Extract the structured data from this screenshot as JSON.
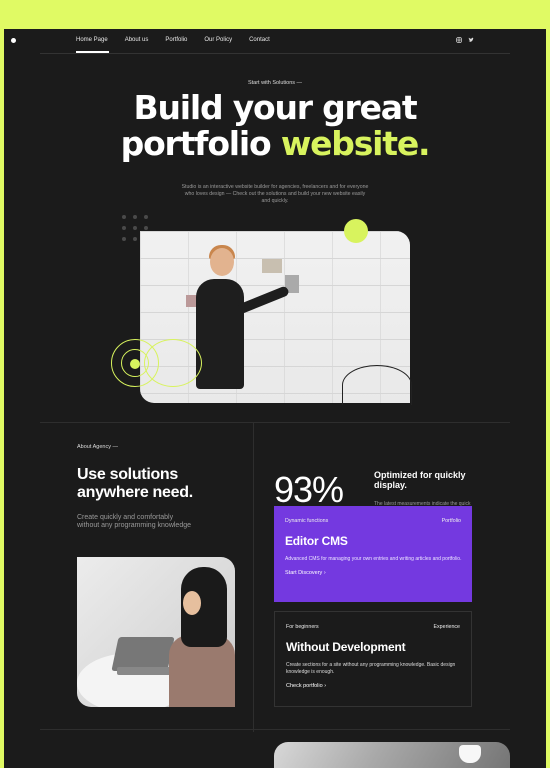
{
  "nav": {
    "items": [
      {
        "label": "Home Page",
        "active": true
      },
      {
        "label": "About us",
        "active": false
      },
      {
        "label": "Portfolio",
        "active": false
      },
      {
        "label": "Our Policy",
        "active": false
      },
      {
        "label": "Contact",
        "active": false
      }
    ],
    "social": [
      "instagram-icon",
      "twitter-icon"
    ]
  },
  "hero": {
    "eyebrow": "Start with Solutions —",
    "title_line1": "Build your great",
    "title_line2_a": "portfolio",
    "title_line2_b": "website.",
    "subtitle": "Studio is an interactive website builder for agencies, freelancers and for everyone who loves design — Check out the solutions and build your new website easily and quickly."
  },
  "about": {
    "eyebrow": "About Agency —",
    "title": "Use solutions anywhere need.",
    "subtitle": "Create quickly and comfortably without any programming knowledge"
  },
  "stat": {
    "value": "93%",
    "title": "Optimized for quickly display.",
    "description": "The latest measurements indicate the quick loading of pages in accordance with the standards for positioning."
  },
  "cards": [
    {
      "tag_left": "Dynamic functions",
      "tag_right": "Portfolio",
      "title": "Editor CMS",
      "description": "Advanced CMS for managing your own entries and writing articles and portfolio.",
      "link": "Start Discovery  ›"
    },
    {
      "tag_left": "For beginners",
      "tag_right": "Experience",
      "title": "Without Development",
      "description": "Create sections for a site without any programming knowledge. Basic design knowledge is enough.",
      "link": "Check portfolio  ›"
    }
  ],
  "colors": {
    "accent": "#d8f35e",
    "purple": "#7439e0",
    "background": "#1b1b1b",
    "outer": "#e0fa64"
  }
}
